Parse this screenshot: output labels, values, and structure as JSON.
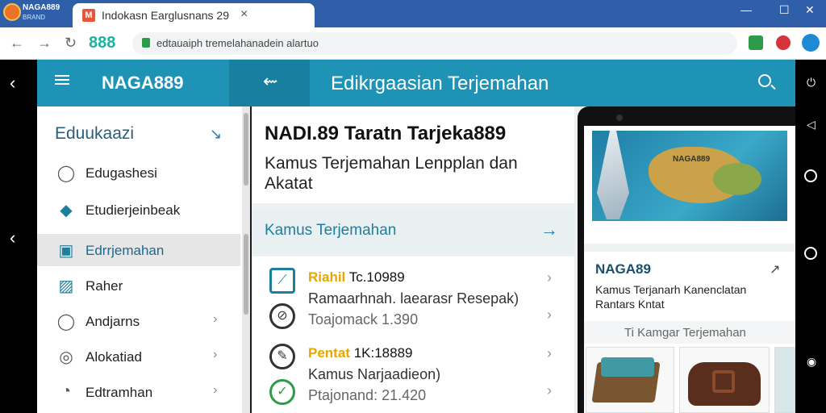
{
  "browser": {
    "app_name": "NAGA889",
    "app_sub": "BRAND",
    "tab_favicon": "M",
    "tab_title": "Indokasn Earglusnans 29",
    "tab_close": "×",
    "window_controls": [
      "—",
      "☐",
      "✕"
    ],
    "brand_label": "888",
    "url": "edtauaiph tremelahanadein alartuo"
  },
  "header": {
    "title": "NAGA889",
    "section_title": "Edikrgaasian Terjemahan"
  },
  "sidebar": {
    "heading": "Eduukaazi",
    "items": [
      {
        "label": "Edugashesi",
        "icon": "user-outline-icon",
        "glyph": "◯",
        "chevron": false
      },
      {
        "label": "Etudierjeinbeak",
        "icon": "bird-icon",
        "glyph": "◆",
        "chevron": false
      },
      {
        "label": "Edrrjemahan",
        "icon": "edit-square-icon",
        "glyph": "▣",
        "chevron": false,
        "active": true
      },
      {
        "label": "Raher",
        "icon": "image-icon",
        "glyph": "▨",
        "chevron": false
      },
      {
        "label": "Andjarns",
        "icon": "person-icon",
        "glyph": "◯",
        "chevron": true
      },
      {
        "label": "Alokatiad",
        "icon": "square-target-icon",
        "glyph": "◎",
        "chevron": true
      },
      {
        "label": "Edtramhan",
        "icon": "chat-bubble-icon",
        "glyph": "◔",
        "chevron": true
      }
    ]
  },
  "main": {
    "card_title": "NADI.89 Taratn Tarjeka889",
    "card_subtitle": "Kamus Terjemahan Lenpplan dan Akatat",
    "banner_label": "Kamus Terjemahan",
    "rows": [
      {
        "title_highlight": "Riahil",
        "title_rest": " Tc.10989",
        "sub": "Ramaarhnah. laearasr Resepak)",
        "meta": "Toajomack  1.390"
      },
      {
        "title_highlight": "Pentat",
        "title_rest": " 1K:18889",
        "sub": "Kamus Narjaadieon)",
        "meta": "Ptajonand:  21.420"
      }
    ]
  },
  "phone": {
    "map_label": "NAGA889",
    "card_title": "NAGA89",
    "card_subtitle": "Kamus Terjanarh Kanenclatan Rantars Kntat",
    "section_label": "Ti Kamgar Terjemahan"
  }
}
